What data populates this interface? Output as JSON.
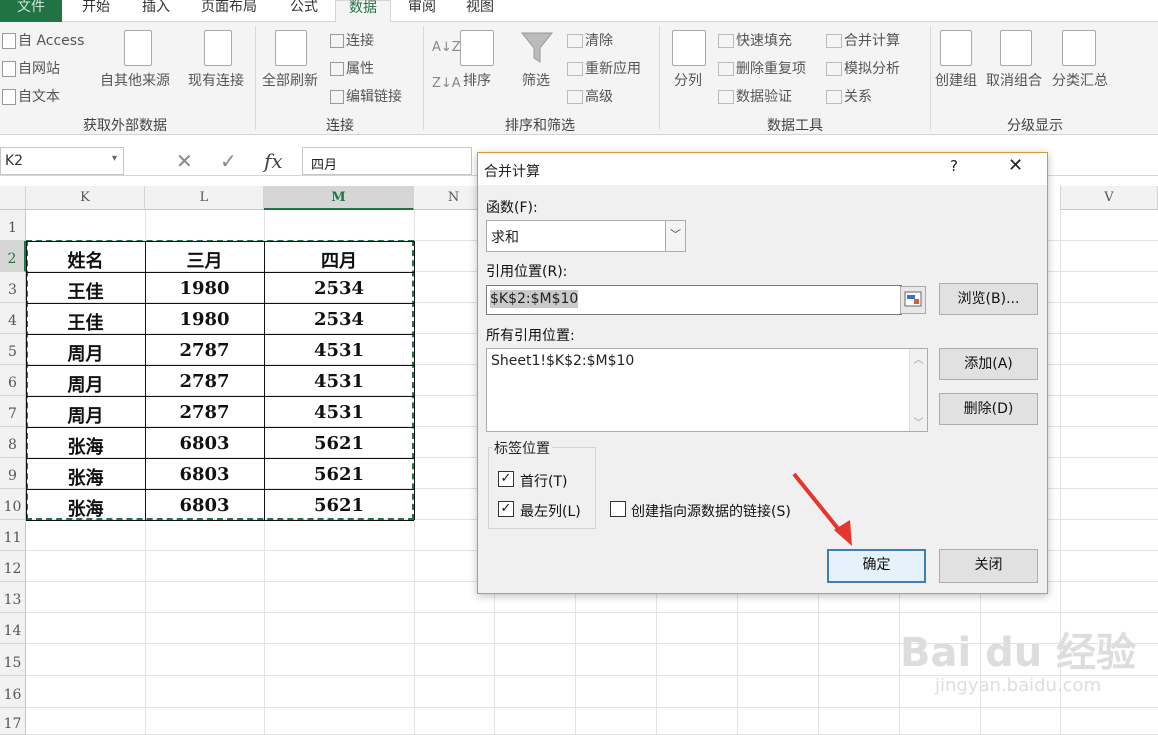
{
  "tabs": [
    "文件",
    "开始",
    "插入",
    "页面布局",
    "公式",
    "数据",
    "审阅",
    "视图"
  ],
  "ribbon": {
    "get_external": {
      "access": "自 Access",
      "web": "自网站",
      "text": "自文本",
      "other": "自其他来源",
      "existing": "现有连接",
      "label": "获取外部数据"
    },
    "connections": {
      "refresh_all": "全部刷新",
      "connections": "连接",
      "properties": "属性",
      "edit_links": "编辑链接",
      "label": "连接"
    },
    "sort_filter": {
      "sort": "排序",
      "filter": "筛选",
      "clear": "清除",
      "reapply": "重新应用",
      "advanced": "高级",
      "label": "排序和筛选"
    },
    "data_tools": {
      "split": "分列",
      "flash_fill": "快速填充",
      "remove_dup": "删除重复项",
      "validation": "数据验证",
      "consolidate": "合并计算",
      "what_if": "模拟分析",
      "relations": "关系",
      "label": "数据工具"
    },
    "outline": {
      "group": "创建组",
      "ungroup": "取消组合",
      "subtotal": "分类汇总",
      "label": "分级显示"
    }
  },
  "formula_bar": {
    "name_box": "K2",
    "fx": "fx",
    "content": "四月"
  },
  "sheet": {
    "columns": [
      "K",
      "L",
      "M",
      "N",
      "V"
    ],
    "rows": [
      "1",
      "2",
      "3",
      "4",
      "5",
      "6",
      "7",
      "8",
      "9",
      "10",
      "11",
      "12",
      "13",
      "14",
      "15",
      "16",
      "17"
    ],
    "table_header": [
      "姓名",
      "三月",
      "四月"
    ],
    "table_rows": [
      [
        "王佳",
        "1980",
        "2534"
      ],
      [
        "王佳",
        "1980",
        "2534"
      ],
      [
        "周月",
        "2787",
        "4531"
      ],
      [
        "周月",
        "2787",
        "4531"
      ],
      [
        "周月",
        "2787",
        "4531"
      ],
      [
        "张海",
        "6803",
        "5621"
      ],
      [
        "张海",
        "6803",
        "5621"
      ],
      [
        "张海",
        "6803",
        "5621"
      ]
    ]
  },
  "dialog": {
    "title": "合并计算",
    "help": "?",
    "close": "✕",
    "function_label": "函数(F):",
    "function_value": "求和",
    "ref_label": "引用位置(R):",
    "ref_value": "$K$2:$M$10",
    "browse": "浏览(B)...",
    "all_refs_label": "所有引用位置:",
    "all_refs": [
      "Sheet1!$K$2:$M$10"
    ],
    "add": "添加(A)",
    "delete": "删除(D)",
    "labels_group": "标签位置",
    "top_row": "首行(T)",
    "left_col": "最左列(L)",
    "create_links": "创建指向源数据的链接(S)",
    "ok": "确定",
    "close_btn": "关闭"
  },
  "watermark": {
    "logo": "Bai du 经验",
    "url": "jingyan.baidu.com"
  },
  "colors": {
    "accent": "#217346",
    "arrow": "#e8342a"
  }
}
